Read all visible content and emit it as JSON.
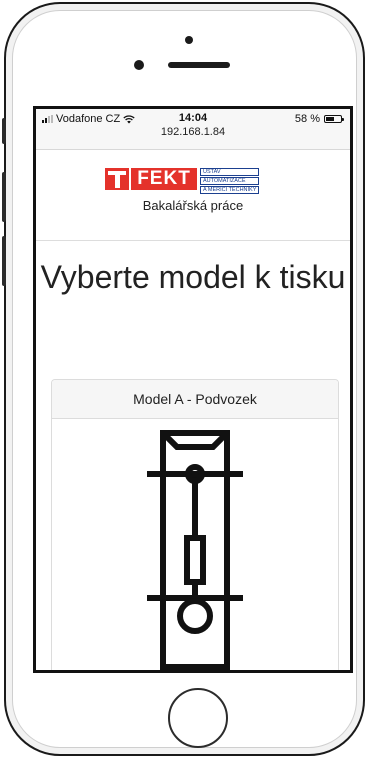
{
  "status_bar": {
    "carrier": "Vodafone CZ",
    "time": "14:04",
    "url": "192.168.1.84",
    "battery_percent": "58 %",
    "battery_level": 0.58
  },
  "header": {
    "logo_text": "FEKT",
    "logo_dept_lines": [
      "ÚSTAV",
      "AUTOMATIZACE",
      "A MĚŘICÍ TECHNIKY"
    ],
    "subtitle": "Bakalářská práce"
  },
  "main": {
    "title": "Vyberte model k tisku",
    "card": {
      "title": "Model A - Podvozek",
      "icon": "chassis-icon"
    }
  },
  "colors": {
    "logo_red": "#e4322b",
    "logo_blue": "#1b3f8f",
    "text": "#222222"
  }
}
